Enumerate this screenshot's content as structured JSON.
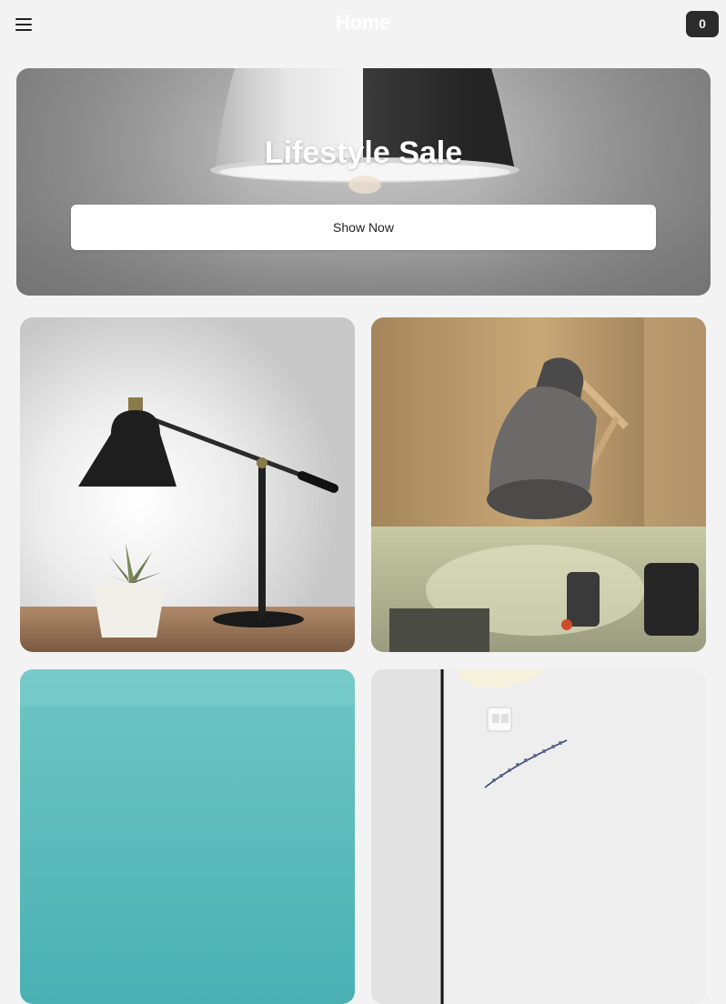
{
  "header": {
    "menu_icon": "hamburger-menu-icon",
    "title": "Home",
    "cart_count": "0"
  },
  "hero": {
    "title": "Lifestyle Sale",
    "button_label": "Show Now"
  },
  "products": [
    {
      "image": "black-desk-lamp-with-plant"
    },
    {
      "image": "grey-adjustable-lamp-on-wood"
    },
    {
      "image": "teal-wall-photo"
    },
    {
      "image": "pendant-lamp-white-wall"
    }
  ],
  "colors": {
    "background": "#f3f3f3",
    "badge": "#2b2b2b",
    "button": "#ffffff"
  }
}
